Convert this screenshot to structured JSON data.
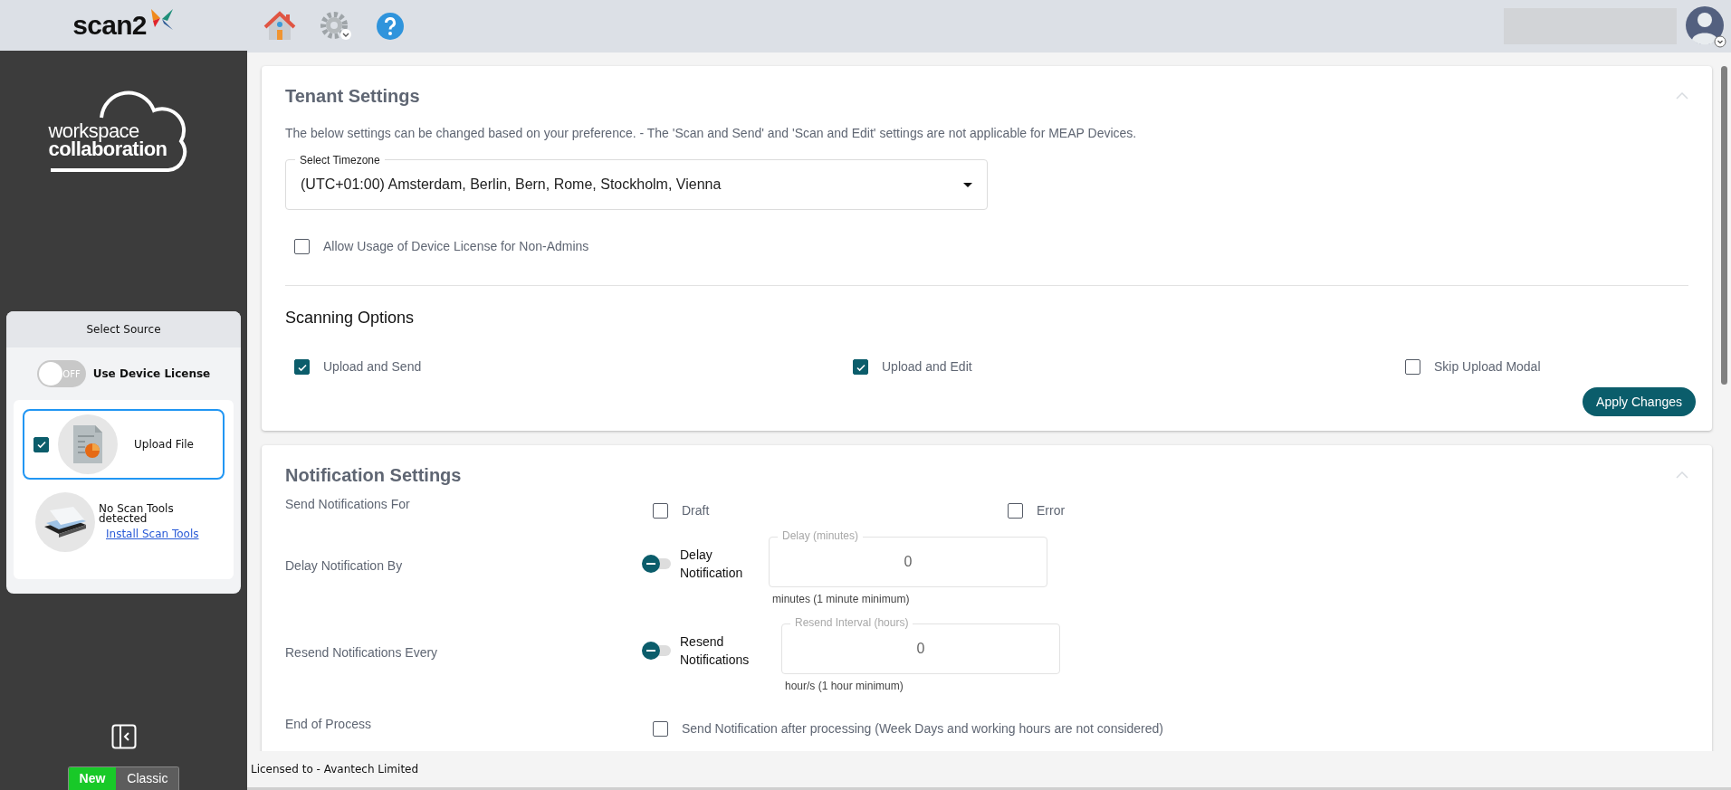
{
  "header": {
    "logo_text": "scan2"
  },
  "sidebar": {
    "brand_line1": "workspace",
    "brand_line2": "collaboration",
    "source_panel": {
      "title": "Select Source",
      "device_license": {
        "label": "Use Device License",
        "on": false,
        "off_text": "OFF"
      },
      "sources": [
        {
          "kind": "upload",
          "label": "Upload File",
          "selected": true,
          "checked": true
        },
        {
          "kind": "scanner",
          "label": "No Scan Tools detected",
          "link": "Install Scan Tools"
        }
      ]
    },
    "mode_switch": [
      {
        "label": "New",
        "selected": true
      },
      {
        "label": "Classic",
        "selected": false
      }
    ]
  },
  "tenant_settings": {
    "title": "Tenant Settings",
    "description": "The below settings can be changed based on your preference. - The 'Scan and Send' and 'Scan and Edit' settings are not applicable for MEAP Devices.",
    "timezone": {
      "label": "Select Timezone",
      "value": "(UTC+01:00) Amsterdam, Berlin, Bern, Rome, Stockholm, Vienna"
    },
    "allow_device_license": {
      "label": "Allow Usage of Device License for Non-Admins",
      "checked": false
    },
    "scanning_options_title": "Scanning Options",
    "scanning_options": [
      {
        "label": "Upload and Send",
        "checked": true
      },
      {
        "label": "Upload and Edit",
        "checked": true
      },
      {
        "label": "Skip Upload Modal",
        "checked": false
      }
    ],
    "apply_button": "Apply Changes"
  },
  "notification_settings": {
    "title": "Notification Settings",
    "send_for": {
      "label": "Send Notifications For",
      "options": [
        {
          "label": "Draft",
          "checked": false
        },
        {
          "label": "Error",
          "checked": false
        }
      ]
    },
    "rows": [
      {
        "label": "Delay Notification By",
        "toggle_label": "Delay Notification",
        "on": false,
        "field_label": "Delay (minutes)",
        "value": "0",
        "helper": "minutes (1 minute minimum)"
      },
      {
        "label": "Resend Notifications Every",
        "toggle_label": "Resend Notifications",
        "on": false,
        "field_label": "Resend Interval (hours)",
        "value": "0",
        "helper": "hour/s (1 hour minimum)"
      }
    ],
    "end_of_process": {
      "label": "End of Process",
      "option": "Send Notification after processing (Week Days and working hours are not considered)",
      "checked": false
    }
  },
  "footer": {
    "license": "Licensed to - Avantech Limited"
  }
}
